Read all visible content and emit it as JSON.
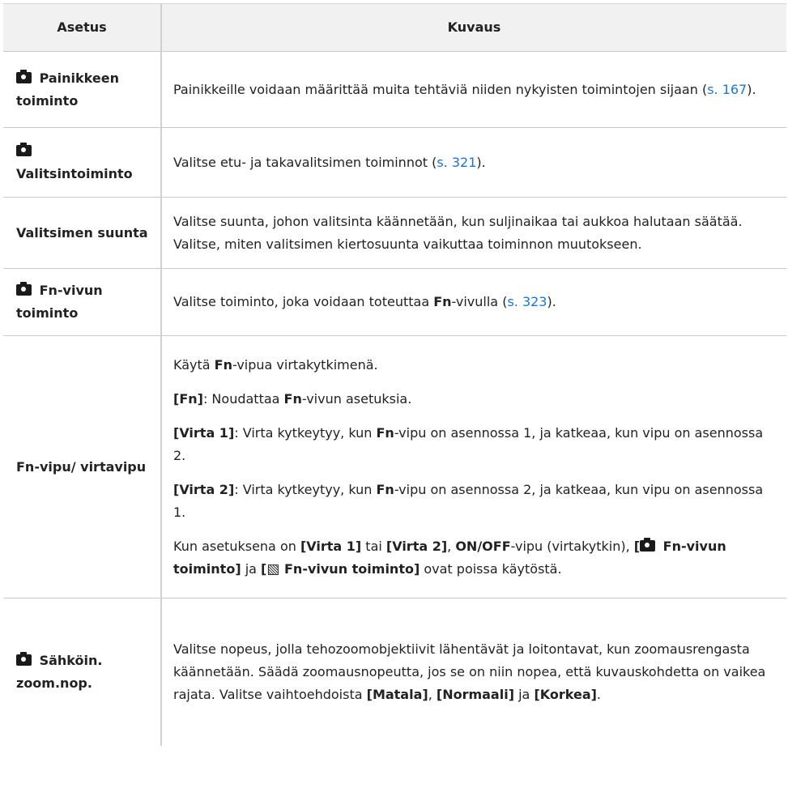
{
  "header": {
    "col1": "Asetus",
    "col2": "Kuvaus"
  },
  "rows": [
    {
      "setting": "Painikkeen toiminto",
      "desc_before": "Painikkeille voidaan määrittää muita tehtäviä niiden nykyisten toimintojen sijaan (",
      "link": "s. 167",
      "desc_after": ")."
    },
    {
      "setting": "Valitsintoiminto",
      "desc_before": "Valitse etu- ja takavalitsimen toiminnot (",
      "link": "s. 321",
      "desc_after": ")."
    },
    {
      "setting": "Valitsimen suunta",
      "desc": "Valitse suunta, johon valitsinta käännetään, kun suljinaikaa tai aukkoa halutaan säätää. Valitse, miten valitsimen kiertosuunta vaikuttaa toiminnon muutokseen."
    },
    {
      "setting": "Fn-vivun toiminto",
      "desc_before": "Valitse toiminto, joka voidaan toteuttaa ",
      "desc_bold": "Fn",
      "desc_mid": "-vivulla (",
      "link": "s. 323",
      "desc_after": ")."
    },
    {
      "setting": "Fn-vipu/ virtavipu",
      "p1_before": "Käytä ",
      "p1_bold": "Fn",
      "p1_after": "-vipua virtakytkimenä.",
      "p2_label": "[Fn]",
      "p2_text1": ": Noudattaa ",
      "p2_bold": "Fn",
      "p2_text2": "-vivun asetuksia.",
      "p3_label": "[Virta 1]",
      "p3_text1": ": Virta kytkeytyy, kun ",
      "p3_bold": "Fn",
      "p3_text2": "-vipu on asennossa 1, ja katkeaa, kun vipu on asennossa 2.",
      "p4_label": "[Virta 2]",
      "p4_text1": ": Virta kytkeytyy, kun ",
      "p4_bold": "Fn",
      "p4_text2": "-vipu on asennossa 2, ja katkeaa, kun vipu on asennossa 1.",
      "p5_text1": "Kun asetuksena on ",
      "p5_b1": "[Virta 1]",
      "p5_text2": " tai ",
      "p5_b2": "[Virta 2]",
      "p5_text3": ", ",
      "p5_b3": "ON/OFF",
      "p5_text4": "-vipu (virtakytkin), ",
      "p5_b4_open": "[",
      "p5_b4_label": " Fn-vivun toiminto]",
      "p5_text5": " ja ",
      "p5_b5_open": "[",
      "p5_b5_label": " Fn-vivun toiminto]",
      "p5_text6": " ovat poissa käytöstä."
    },
    {
      "setting": "Sähköin. zoom.nop.",
      "desc_before": "Valitse nopeus, jolla tehozoomobjektiivit lähentävät ja loitontavat, kun zoomausrengasta käännetään. Säädä zoomausnopeutta, jos se on niin nopea, että kuvauskohdetta on vaikea rajata. Valitse vaihtoehdoista ",
      "b1": "[Matala]",
      "mid1": ", ",
      "b2": "[Normaali]",
      "mid2": " ja ",
      "b3": "[Korkea]",
      "desc_after": "."
    }
  ],
  "colors": {
    "header_bg": "#f1f1f1",
    "link": "#1b76d1",
    "border": "#c9c9c9"
  },
  "icons": [
    "camera-icon",
    "movie-icon"
  ]
}
